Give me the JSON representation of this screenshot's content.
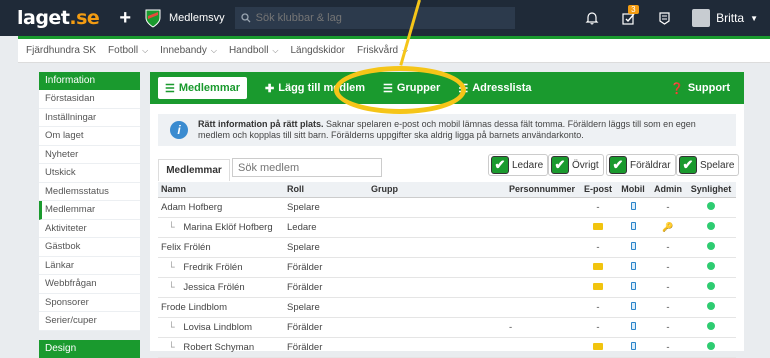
{
  "topbar": {
    "logo_main": "laget",
    "logo_tld": ".se",
    "club_name": "Medlemsvy",
    "search_placeholder": "Sök klubbar & lag",
    "notification_badge": "3",
    "user_name": "Britta",
    "bg_color": "#1f2a38",
    "accent_color": "#1a9a2e"
  },
  "subnav": [
    "Fjärdhundra SK",
    "Fotboll",
    "Innebandy",
    "Handboll",
    "Längdskidor",
    "Friskvård"
  ],
  "sidebar": {
    "section1": "Information",
    "items1": [
      "Förstasidan",
      "Inställningar",
      "Om laget",
      "Nyheter",
      "Utskick",
      "Medlemsstatus",
      "Medlemmar",
      "Aktiviteter",
      "Gästbok",
      "Länkar",
      "Webbfrågan",
      "Sponsorer",
      "Serier/cuper"
    ],
    "active": "Medlemmar",
    "section2": "Design"
  },
  "actionbar": {
    "members": "Medlemmar",
    "add_member": "Lägg till medlem",
    "groups": "Grupper",
    "address_list": "Adresslista",
    "support": "Support"
  },
  "info": {
    "title": "Rätt information på rätt plats.",
    "line1": "Saknar spelaren e-post och mobil lämnas dessa fält tomma. Föräldern läggs till som en egen",
    "line2": "medlem och kopplas till sitt barn. Förälderns uppgifter ska aldrig ligga på barnets användarkonto."
  },
  "tabs": {
    "members_tab": "Medlemmar",
    "search_placeholder": "Sök medlem"
  },
  "filters": [
    "Ledare",
    "Övrigt",
    "Föräldrar",
    "Spelare"
  ],
  "table": {
    "headers": [
      "Namn",
      "Roll",
      "Grupp",
      "Personnummer",
      "E-post",
      "Mobil",
      "Admin",
      "Synlighet"
    ],
    "rows": [
      {
        "name": "Adam Hofberg",
        "role": "Spelare",
        "child": false,
        "email": "-",
        "admin": "-"
      },
      {
        "name": "Marina Eklöf Hofberg",
        "role": "Ledare",
        "child": true,
        "email": "mail",
        "admin": "key"
      },
      {
        "name": "Felix Frölén",
        "role": "Spelare",
        "child": false,
        "email": "-",
        "admin": "-"
      },
      {
        "name": "Fredrik Frölén",
        "role": "Förälder",
        "child": true,
        "email": "mail",
        "admin": "-"
      },
      {
        "name": "Jessica Frölén",
        "role": "Förälder",
        "child": true,
        "email": "mail",
        "admin": "-"
      },
      {
        "name": "Frode Lindblom",
        "role": "Spelare",
        "child": false,
        "email": "-",
        "admin": "-"
      },
      {
        "name": "Lovisa Lindblom",
        "role": "Förälder",
        "child": true,
        "email": "-",
        "admin": "-",
        "pnr": "-"
      },
      {
        "name": "Robert Schyman",
        "role": "Förälder",
        "child": true,
        "email": "mail",
        "admin": "-"
      }
    ]
  }
}
